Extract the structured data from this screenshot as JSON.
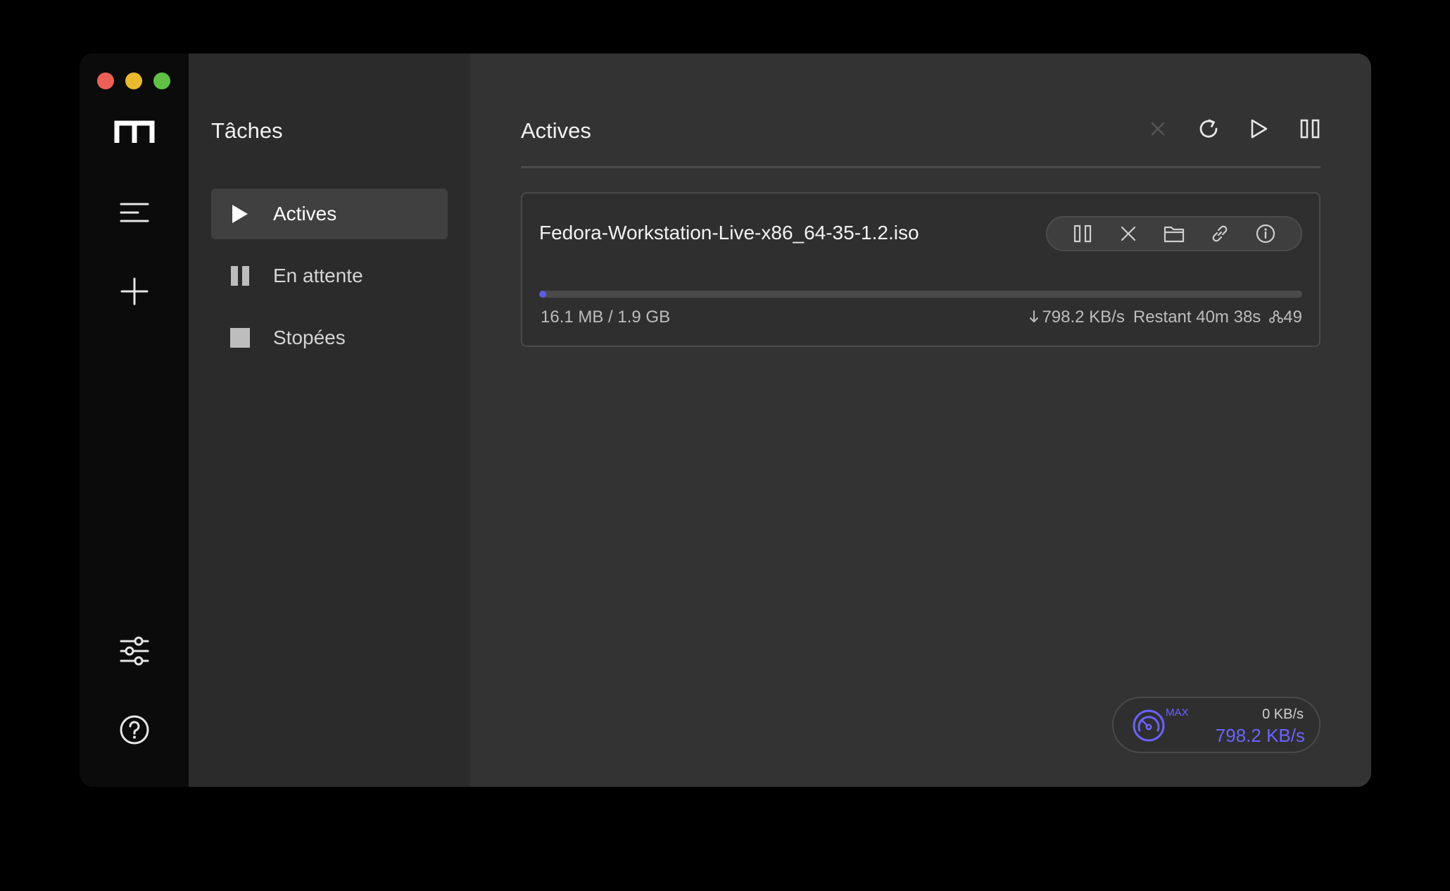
{
  "sidebar": {
    "title": "Tâches",
    "items": [
      {
        "label": "Actives"
      },
      {
        "label": "En attente"
      },
      {
        "label": "Stopées"
      }
    ]
  },
  "main": {
    "title": "Actives"
  },
  "task": {
    "name": "Fedora-Workstation-Live-x86_64-35-1.2.iso",
    "size": "16.1 MB / 1.9 GB",
    "speed": "798.2 KB/s",
    "remaining": "Restant 40m 38s",
    "connections": "49",
    "progress": 0.008
  },
  "speedometer": {
    "max_label": "MAX",
    "upload": "0 KB/s",
    "download": "798.2 KB/s"
  },
  "colors": {
    "accent": "#5b5ce6"
  },
  "icons": {
    "rail": [
      "logo-icon",
      "menu-icon",
      "plus-icon",
      "sliders-icon",
      "help-icon"
    ],
    "toolbar": [
      "close-icon",
      "refresh-icon",
      "play-icon",
      "pause-icon"
    ],
    "task_actions": [
      "pause-icon",
      "close-icon",
      "folder-icon",
      "link-icon",
      "info-icon"
    ]
  }
}
